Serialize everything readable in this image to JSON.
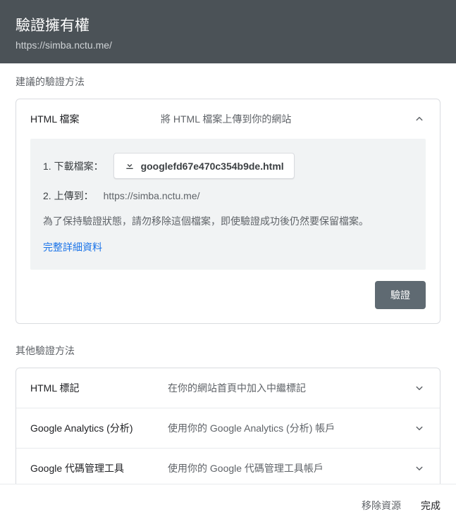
{
  "header": {
    "title": "驗證擁有權",
    "subtitle": "https://simba.nctu.me/"
  },
  "recommended": {
    "section_label": "建議的驗證方法",
    "title": "HTML 檔案",
    "desc": "將 HTML 檔案上傳到你的網站",
    "step1_label": "1. 下載檔案：",
    "download_filename": "googlefd67e470c354b9de.html",
    "step2_label": "2. 上傳到：",
    "step2_url": "https://simba.nctu.me/",
    "note": "為了保持驗證狀態，請勿移除這個檔案，即使驗證成功後仍然要保留檔案。",
    "details_link": "完整詳細資料",
    "verify_button": "驗證"
  },
  "other": {
    "section_label": "其他驗證方法",
    "methods": [
      {
        "title": "HTML 標記",
        "desc": "在你的網站首頁中加入中繼標記"
      },
      {
        "title": "Google Analytics (分析)",
        "desc": "使用你的 Google Analytics (分析) 帳戶"
      },
      {
        "title": "Google 代碼管理工具",
        "desc": "使用你的 Google 代碼管理工具帳戶"
      }
    ]
  },
  "footer": {
    "remove": "移除資源",
    "done": "完成"
  }
}
